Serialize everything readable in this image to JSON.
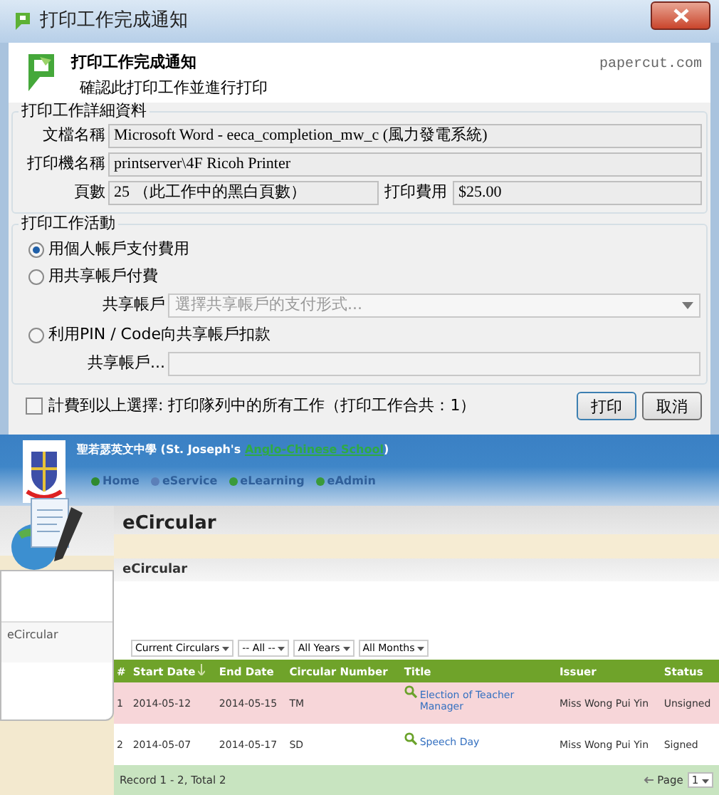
{
  "dialog": {
    "title": "打印工作完成通知",
    "header_title": "打印工作完成通知",
    "header_subtitle": "確認此打印工作並進行打印",
    "brand": "papercut.com",
    "details": {
      "legend": "打印工作詳細資料",
      "fields": [
        {
          "label": "文檔名稱",
          "value": "Microsoft Word - eeca_completion_mw_c (風力發電系統)"
        },
        {
          "label": "打印機名稱",
          "value": "printserver\\4F Ricoh Printer"
        }
      ],
      "pages_label": "頁數",
      "pages": "25 （此工作中的黑白頁數）",
      "cost_label": "打印費用",
      "cost": "$25.00"
    },
    "activity": {
      "legend": "打印工作活動",
      "options": [
        {
          "label": "用個人帳戶支付費用",
          "selected": true,
          "kind": "plain"
        },
        {
          "label": "用共享帳戶付費",
          "selected": false,
          "kind": "dropdown",
          "field_label": "共享帳戶",
          "placeholder": "選擇共享帳戶的支付形式..."
        },
        {
          "label": "利用PIN / Code向共享帳戶扣款",
          "selected": false,
          "kind": "text",
          "field_label": "共享帳戶..."
        }
      ]
    },
    "apply_all": {
      "label": "計費到以上選擇: 打印隊列中的所有工作（打印工作合共：1）",
      "checked": false
    },
    "buttons": [
      "打印",
      "取消"
    ]
  },
  "web": {
    "school_name": "聖若瑟英文中學 (St. Joseph's ",
    "school_link": "Anglo-Chinese School",
    "school_close": ")",
    "nav": [
      "Home",
      "eService",
      "eLearning",
      "eAdmin"
    ],
    "page_title": "eCircular",
    "section_title": "eCircular",
    "sidebar_items": [
      "eCircular"
    ],
    "filters": [
      "Current Circulars",
      "-- All --",
      "All Years",
      "All Months"
    ],
    "columns": [
      "#",
      "Start Date",
      "End Date",
      "Circular Number",
      "Title",
      "Issuer",
      "Status"
    ],
    "rows": [
      {
        "cells": [
          "1",
          "2014-05-12",
          "2014-05-15",
          "TM",
          "Election of Teacher Manager",
          "Miss Wong Pui Yin",
          "Unsigned"
        ],
        "highlighted": true
      },
      {
        "cells": [
          "2",
          "2014-05-07",
          "2014-05-17",
          "SD",
          "Speech Day",
          "Miss Wong Pui Yin",
          "Signed"
        ],
        "highlighted": false
      }
    ],
    "record_info": "Record 1 - 2, Total 2",
    "page_label": "Page",
    "page": "1"
  }
}
